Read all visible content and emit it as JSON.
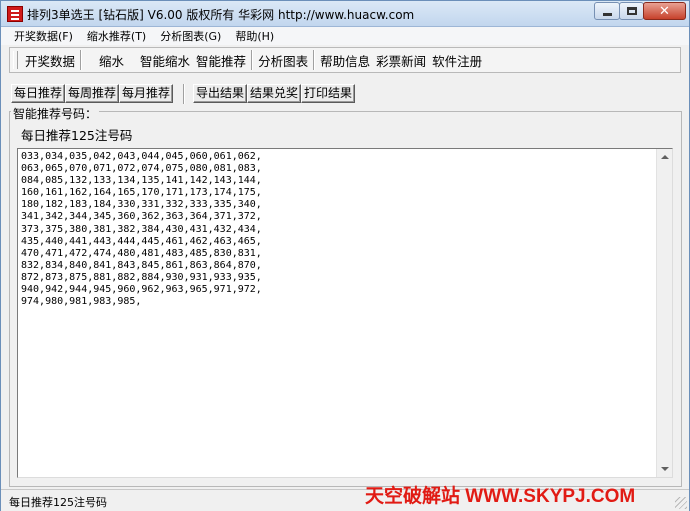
{
  "window": {
    "title": "排列3单选王 [钻石版] V6.00  版权所有 华彩网 http://www.huacw.com"
  },
  "menu": [
    {
      "label": "开奖数据(F)"
    },
    {
      "label": "缩水推荐(T)"
    },
    {
      "label": "分析图表(G)"
    },
    {
      "label": "帮助(H)"
    }
  ],
  "toolbar": {
    "buttons": [
      {
        "label": "开奖数据"
      },
      {
        "label": "缩水"
      },
      {
        "label": "智能缩水"
      },
      {
        "label": "智能推荐"
      },
      {
        "label": "分析图表"
      },
      {
        "label": "帮助信息"
      },
      {
        "label": "彩票新闻"
      },
      {
        "label": "软件注册"
      }
    ]
  },
  "tabs": [
    {
      "label": "每日推荐"
    },
    {
      "label": "每周推荐"
    },
    {
      "label": "每月推荐"
    }
  ],
  "actions": [
    {
      "label": "导出结果"
    },
    {
      "label": "结果兑奖"
    },
    {
      "label": "打印结果"
    }
  ],
  "group": {
    "legend": "智能推荐号码：",
    "summary": "每日推荐125注号码"
  },
  "result_text": "033,034,035,042,043,044,045,060,061,062,\n063,065,070,071,072,074,075,080,081,083,\n084,085,132,133,134,135,141,142,143,144,\n160,161,162,164,165,170,171,173,174,175,\n180,182,183,184,330,331,332,333,335,340,\n341,342,344,345,360,362,363,364,371,372,\n373,375,380,381,382,384,430,431,432,434,\n435,440,441,443,444,445,461,462,463,465,\n470,471,472,474,480,481,483,485,830,831,\n832,834,840,841,843,845,861,863,864,870,\n872,873,875,881,882,884,930,931,933,935,\n940,942,944,945,960,962,963,965,971,972,\n974,980,981,983,985,",
  "status": {
    "text": "每日推荐125注号码"
  },
  "watermark": "天空破解站 WWW.SKYPJ.COM",
  "colors": {
    "watermark": "#e11b14",
    "titlebar": "#c2d6ee",
    "close_button": "#c7412b"
  }
}
